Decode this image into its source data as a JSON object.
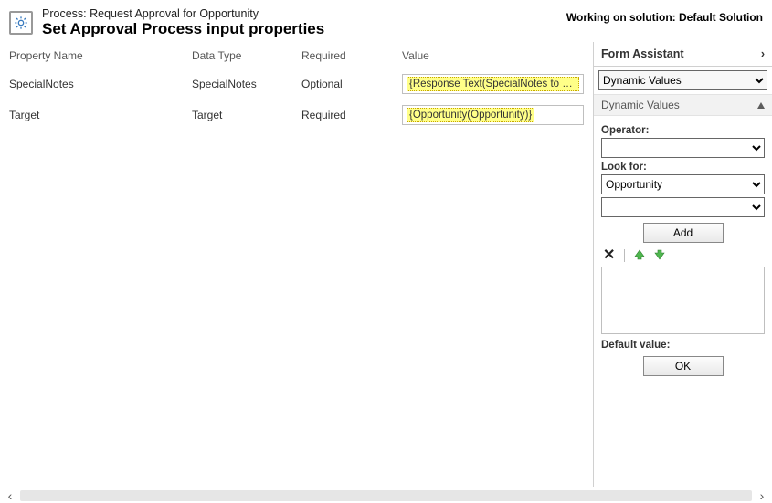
{
  "process_label_prefix": "Process:",
  "process_name": "Request Approval for Opportunity",
  "page_title": "Set Approval Process input properties",
  "working_on": "Working on solution: Default Solution",
  "columns": {
    "property_name": "Property Name",
    "data_type": "Data Type",
    "required": "Required",
    "value": "Value"
  },
  "rows": [
    {
      "property_name": "SpecialNotes",
      "data_type": "SpecialNotes",
      "required": "Optional",
      "value_token": "{Response Text(SpecialNotes to Manager)}"
    },
    {
      "property_name": "Target",
      "data_type": "Target",
      "required": "Required",
      "value_token": "{Opportunity(Opportunity)}"
    }
  ],
  "assist": {
    "header": "Form Assistant",
    "mode_selected": "Dynamic Values",
    "section_label": "Dynamic Values",
    "operator_label": "Operator:",
    "operator_value": "",
    "lookfor_label": "Look for:",
    "lookfor_value": "Opportunity",
    "lookfor_sub_value": "",
    "add_label": "Add",
    "default_label": "Default value:",
    "ok_label": "OK"
  }
}
